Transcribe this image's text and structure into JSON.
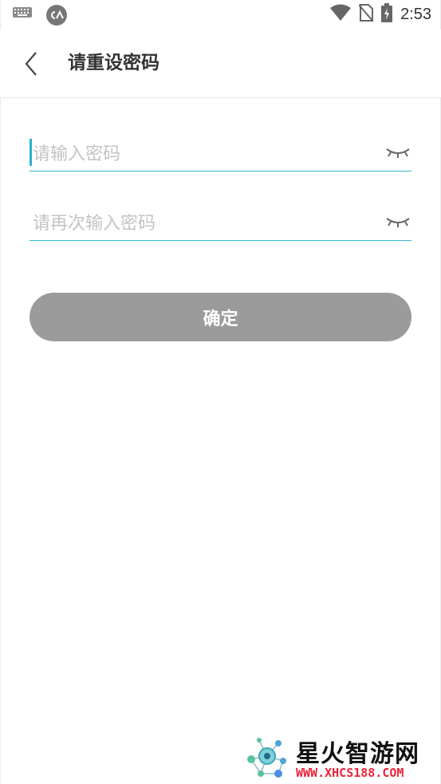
{
  "status_bar": {
    "time": "2:53",
    "icons": [
      "keyboard-icon",
      "app-circle-icon",
      "wifi-icon",
      "no-sim-icon",
      "battery-charging-icon"
    ]
  },
  "header": {
    "title": "请重设密码",
    "back_icon": "chevron-left-icon"
  },
  "form": {
    "password": {
      "placeholder": "请输入密码",
      "value": "",
      "toggle_icon": "eye-closed-icon"
    },
    "confirm_password": {
      "placeholder": "请再次输入密码",
      "value": "",
      "toggle_icon": "eye-closed-icon"
    },
    "submit_label": "确定"
  },
  "colors": {
    "accent": "#35b8c9",
    "button_disabled": "#9b9b9b",
    "placeholder": "#c3c3c3",
    "title": "#333333"
  },
  "watermark": {
    "title": "星火智游网",
    "url": "WWW.XHCS188.COM"
  }
}
